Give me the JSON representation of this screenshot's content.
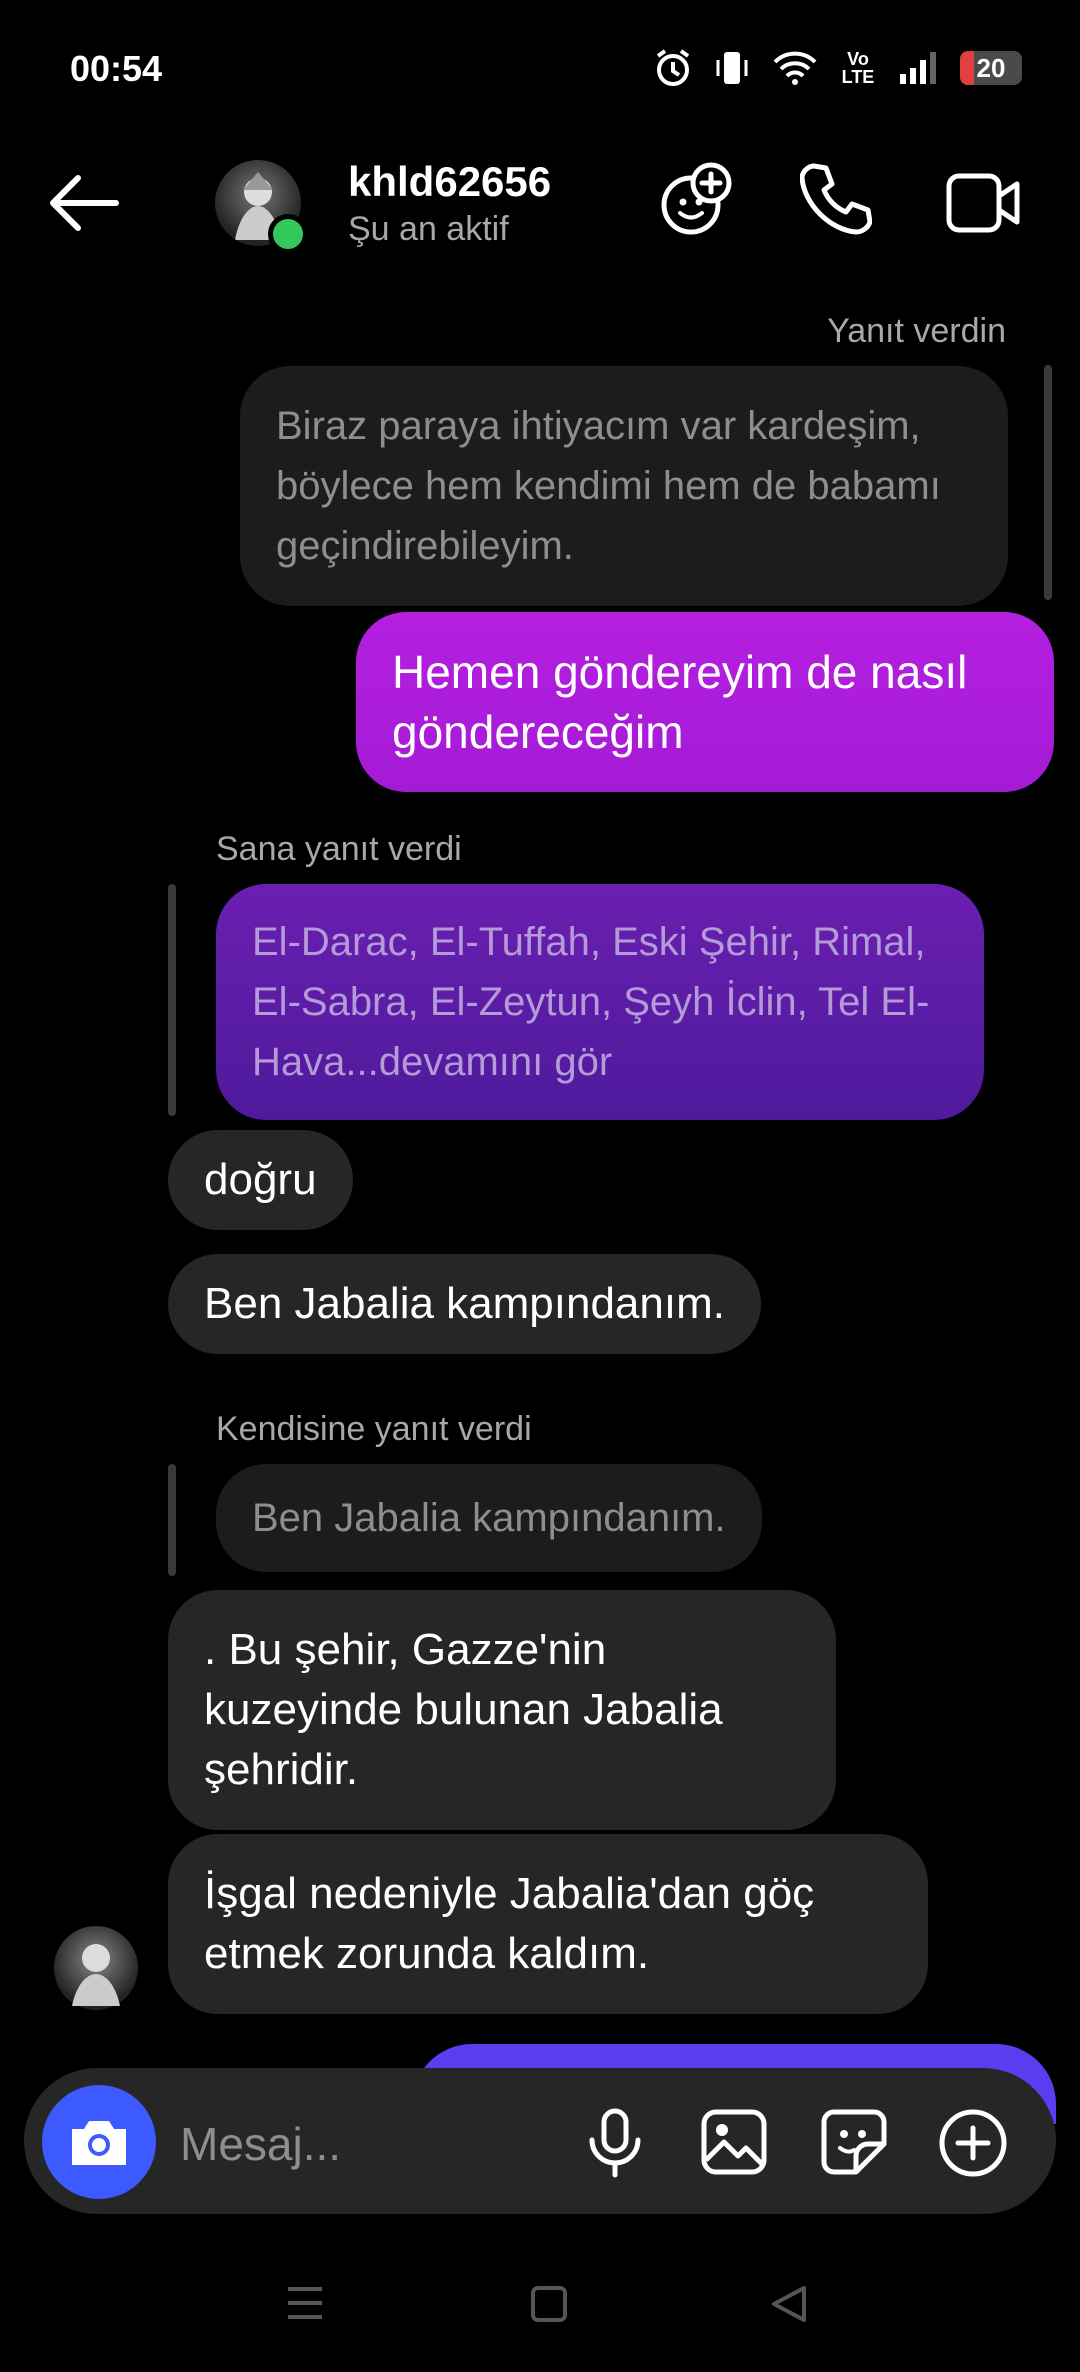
{
  "status_bar": {
    "time": "00:54",
    "battery": "20",
    "network": "Vo LTE"
  },
  "header": {
    "username": "khld62656",
    "status": "Şu an aktif"
  },
  "messages": {
    "m1_meta": "Yanıt verdin",
    "m1_quote": "Biraz paraya ihtiyacım var kardeşim, böylece hem kendimi hem de babamı geçindirebileyim.",
    "m2_out": "Hemen göndereyim de nasıl göndereceğim",
    "m3_meta": "Sana yanıt verdi",
    "m3_quote": "El-Darac, El-Tuffah, Eski Şehir, Rimal, El-Sabra, El-Zeytun, Şeyh İclin, Tel El-Hava...devamını gör",
    "m4": "doğru",
    "m5": "Ben Jabalia kampındanım.",
    "m6_meta": "Kendisine yanıt verdi",
    "m6_quote": "Ben Jabalia kampındanım.",
    "m7": ".   Bu şehir, Gazze'nin kuzeyinde bulunan Jabalia şehridir.",
    "m8": "İşgal nedeniyle Jabalia'dan göç etmek zorunda kaldım."
  },
  "composer": {
    "placeholder": "Mesaj..."
  },
  "colors": {
    "accent": "#3d5afe",
    "outgoing": "#b51fe0",
    "online": "#34c759"
  }
}
